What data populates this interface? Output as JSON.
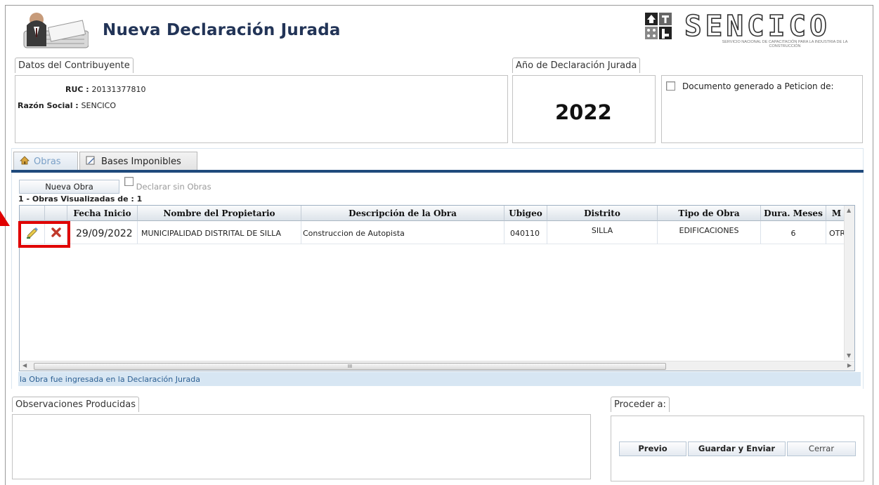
{
  "header": {
    "title": "Nueva Declaración Jurada",
    "logo_text": "SENCICO",
    "logo_subtitle": "SERVICIO NACIONAL DE CAPACITACIÓN PARA LA INDUSTRIA DE LA CONSTRUCCIÓN"
  },
  "contribuyente": {
    "legend": "Datos del Contribuyente",
    "ruc_label": "RUC :",
    "ruc_value": "20131377810",
    "razon_label": "Razón Social :",
    "razon_value": "SENCICO"
  },
  "anio": {
    "legend": "Año de Declaración Jurada",
    "value": "2022"
  },
  "peticion": {
    "label": "Documento generado a Peticion de:"
  },
  "tabs": [
    {
      "label": "Obras",
      "active": true
    },
    {
      "label": "Bases Imponibles",
      "active": false
    }
  ],
  "obras": {
    "nueva_button": "Nueva Obra",
    "declarar_label": "Declarar sin Obras",
    "visualizadas": "1 - Obras Visualizadas de : 1",
    "columns": [
      "Fecha Inicio",
      "Nombre del Propietario",
      "Descripción de la Obra",
      "Ubigeo",
      "Distrito",
      "Tipo de Obra",
      "Dura. Meses",
      "M"
    ],
    "rows": [
      {
        "fecha": "29/09/2022",
        "propietario": "MUNICIPALIDAD DISTRITAL DE SILLA",
        "descripcion": "Construccion de Autopista",
        "ubigeo": "040110",
        "distrito": "SILLA",
        "tipo": "EDIFICACIONES",
        "meses": "6",
        "m": "OTR"
      }
    ],
    "scroll_thumb_label": "III",
    "status_message": "la Obra fue ingresada en la Declaración Jurada"
  },
  "observaciones": {
    "legend": "Observaciones Producidas"
  },
  "proceder": {
    "legend": "Proceder a:",
    "previo": "Previo",
    "guardar": "Guardar y Enviar",
    "cerrar": "Cerrar"
  },
  "colors": {
    "title": "#223457",
    "tab_bar": "#1f4a7c",
    "status_bg": "#d7e6f3",
    "highlight": "#e00000"
  }
}
